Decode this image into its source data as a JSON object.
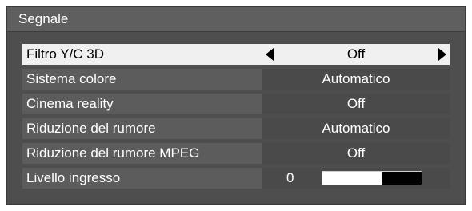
{
  "title": "Segnale",
  "rows": [
    {
      "label": "Filtro Y/C 3D",
      "value": "Off"
    },
    {
      "label": "Sistema colore",
      "value": "Automatico"
    },
    {
      "label": "Cinema reality",
      "value": "Off"
    },
    {
      "label": "Riduzione del rumore",
      "value": "Automatico"
    },
    {
      "label": "Riduzione del rumore MPEG",
      "value": "Off"
    }
  ],
  "level": {
    "label": "Livello ingresso",
    "value": "0",
    "fill_fraction": 0.6
  }
}
